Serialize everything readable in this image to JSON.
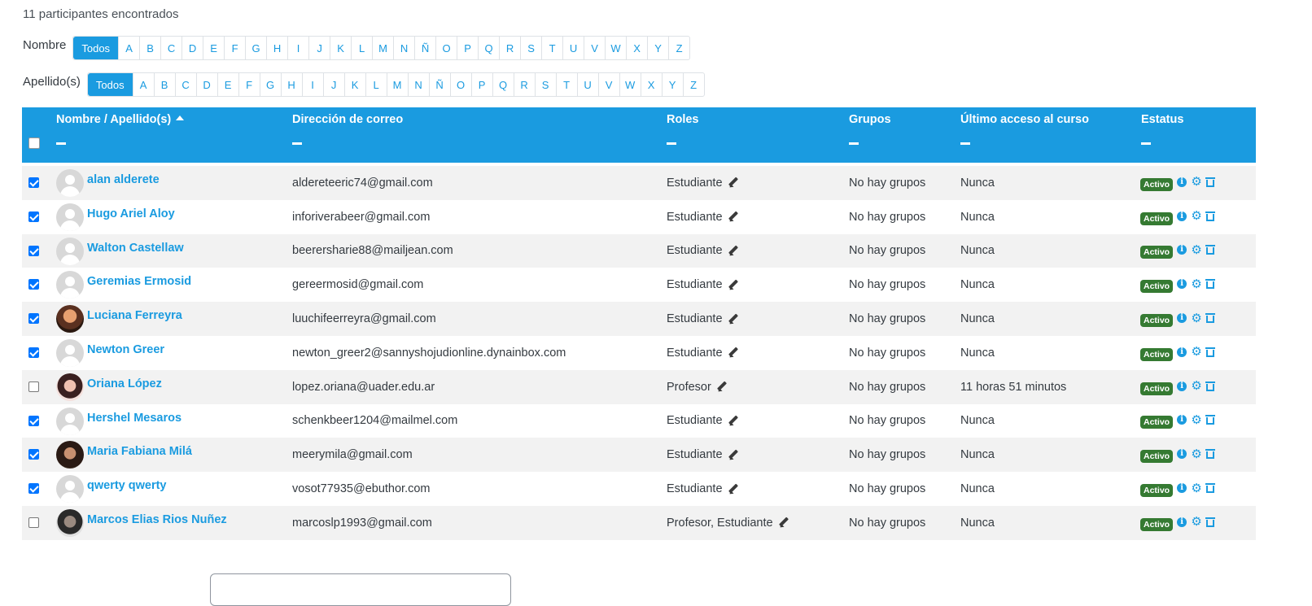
{
  "count_text": "11 participantes encontrados",
  "filters": {
    "first": {
      "label": "Nombre"
    },
    "last": {
      "label": "Apellido(s)"
    },
    "all_label": "Todos",
    "letters": [
      "A",
      "B",
      "C",
      "D",
      "E",
      "F",
      "G",
      "H",
      "I",
      "J",
      "K",
      "L",
      "M",
      "N",
      "Ñ",
      "O",
      "P",
      "Q",
      "R",
      "S",
      "T",
      "U",
      "V",
      "W",
      "X",
      "Y",
      "Z"
    ]
  },
  "table": {
    "headers": {
      "name": "Nombre / Apellido(s)",
      "email": "Dirección de correo",
      "roles": "Roles",
      "groups": "Grupos",
      "access": "Último acceso al curso",
      "status": "Estatus"
    },
    "rows": [
      {
        "checked": true,
        "avatar": "default",
        "name": "alan alderete",
        "email": "aldereteeric74@gmail.com",
        "roles": "Estudiante",
        "groups": "No hay grupos",
        "access": "Nunca",
        "status": "Activo"
      },
      {
        "checked": true,
        "avatar": "default",
        "name": "Hugo Ariel Aloy",
        "email": "inforiverabeer@gmail.com",
        "roles": "Estudiante",
        "groups": "No hay grupos",
        "access": "Nunca",
        "status": "Activo"
      },
      {
        "checked": true,
        "avatar": "default",
        "name": "Walton Castellaw",
        "email": "beerersharie88@mailjean.com",
        "roles": "Estudiante",
        "groups": "No hay grupos",
        "access": "Nunca",
        "status": "Activo"
      },
      {
        "checked": true,
        "avatar": "default",
        "name": "Geremias Ermosid",
        "email": "gereermosid@gmail.com",
        "roles": "Estudiante",
        "groups": "No hay grupos",
        "access": "Nunca",
        "status": "Activo"
      },
      {
        "checked": true,
        "avatar": "photo1",
        "name": "Luciana Ferreyra",
        "email": "luuchifeerreyra@gmail.com",
        "roles": "Estudiante",
        "groups": "No hay grupos",
        "access": "Nunca",
        "status": "Activo"
      },
      {
        "checked": true,
        "avatar": "default",
        "name": "Newton Greer",
        "email": "newton_greer2@sannyshojudionline.dynainbox.com",
        "roles": "Estudiante",
        "groups": "No hay grupos",
        "access": "Nunca",
        "status": "Activo"
      },
      {
        "checked": false,
        "avatar": "photo2",
        "name": "Oriana López",
        "email": "lopez.oriana@uader.edu.ar",
        "roles": "Profesor",
        "groups": "No hay grupos",
        "access": "11 horas 51 minutos",
        "status": "Activo"
      },
      {
        "checked": true,
        "avatar": "default",
        "name": "Hershel Mesaros",
        "email": "schenkbeer1204@mailmel.com",
        "roles": "Estudiante",
        "groups": "No hay grupos",
        "access": "Nunca",
        "status": "Activo"
      },
      {
        "checked": true,
        "avatar": "photo3",
        "name": "Maria Fabiana Milá",
        "email": "meerymila@gmail.com",
        "roles": "Estudiante",
        "groups": "No hay grupos",
        "access": "Nunca",
        "status": "Activo"
      },
      {
        "checked": true,
        "avatar": "default",
        "name": "qwerty qwerty",
        "email": "vosot77935@ebuthor.com",
        "roles": "Estudiante",
        "groups": "No hay grupos",
        "access": "Nunca",
        "status": "Activo"
      },
      {
        "checked": false,
        "avatar": "photo4",
        "name": "Marcos Elias Rios Nuñez",
        "email": "marcoslp1993@gmail.com",
        "roles": "Profesor, Estudiante",
        "groups": "No hay grupos",
        "access": "Nunca",
        "status": "Activo"
      }
    ]
  },
  "colors": {
    "accent": "#1a9be0",
    "active_badge": "#357a32"
  },
  "icons": [
    "info-icon",
    "gear-icon",
    "trash-icon",
    "pencil-icon",
    "sort-asc-icon"
  ]
}
